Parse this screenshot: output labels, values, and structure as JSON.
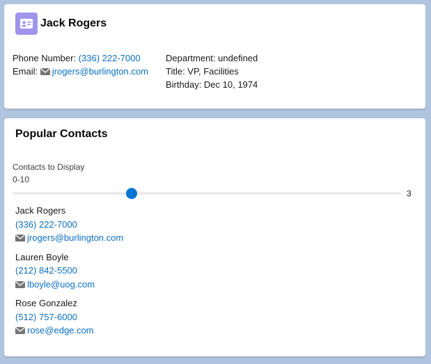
{
  "contact": {
    "name": "Jack Rogers",
    "phone_label": "Phone Number:",
    "phone": "(336) 222-7000",
    "email_label": "Email:",
    "email": "jrogers@burlington.com",
    "department": "Department: undefined",
    "title": "Title: VP, Facilities",
    "birthday": "Birthday: Dec 10, 1974"
  },
  "popular": {
    "title": "Popular Contacts",
    "slider_label": "Contacts to Display",
    "slider_range": "0-10",
    "slider_value": "3",
    "slider_fraction": 0.3,
    "items": [
      {
        "name": "Jack Rogers",
        "phone": "(336) 222-7000",
        "email": "jrogers@burlington.com"
      },
      {
        "name": "Lauren Boyle",
        "phone": "(212) 842-5500",
        "email": "lboyle@uog.com"
      },
      {
        "name": "Rose Gonzalez",
        "phone": "(512) 757-6000",
        "email": "rose@edge.com"
      }
    ]
  },
  "colors": {
    "background": "#b0c4df",
    "accent": "#0176d3",
    "link": "#0b6fc2",
    "contact_icon": "#a094ed"
  },
  "icons": [
    "contact-card-icon",
    "mail-icon"
  ]
}
